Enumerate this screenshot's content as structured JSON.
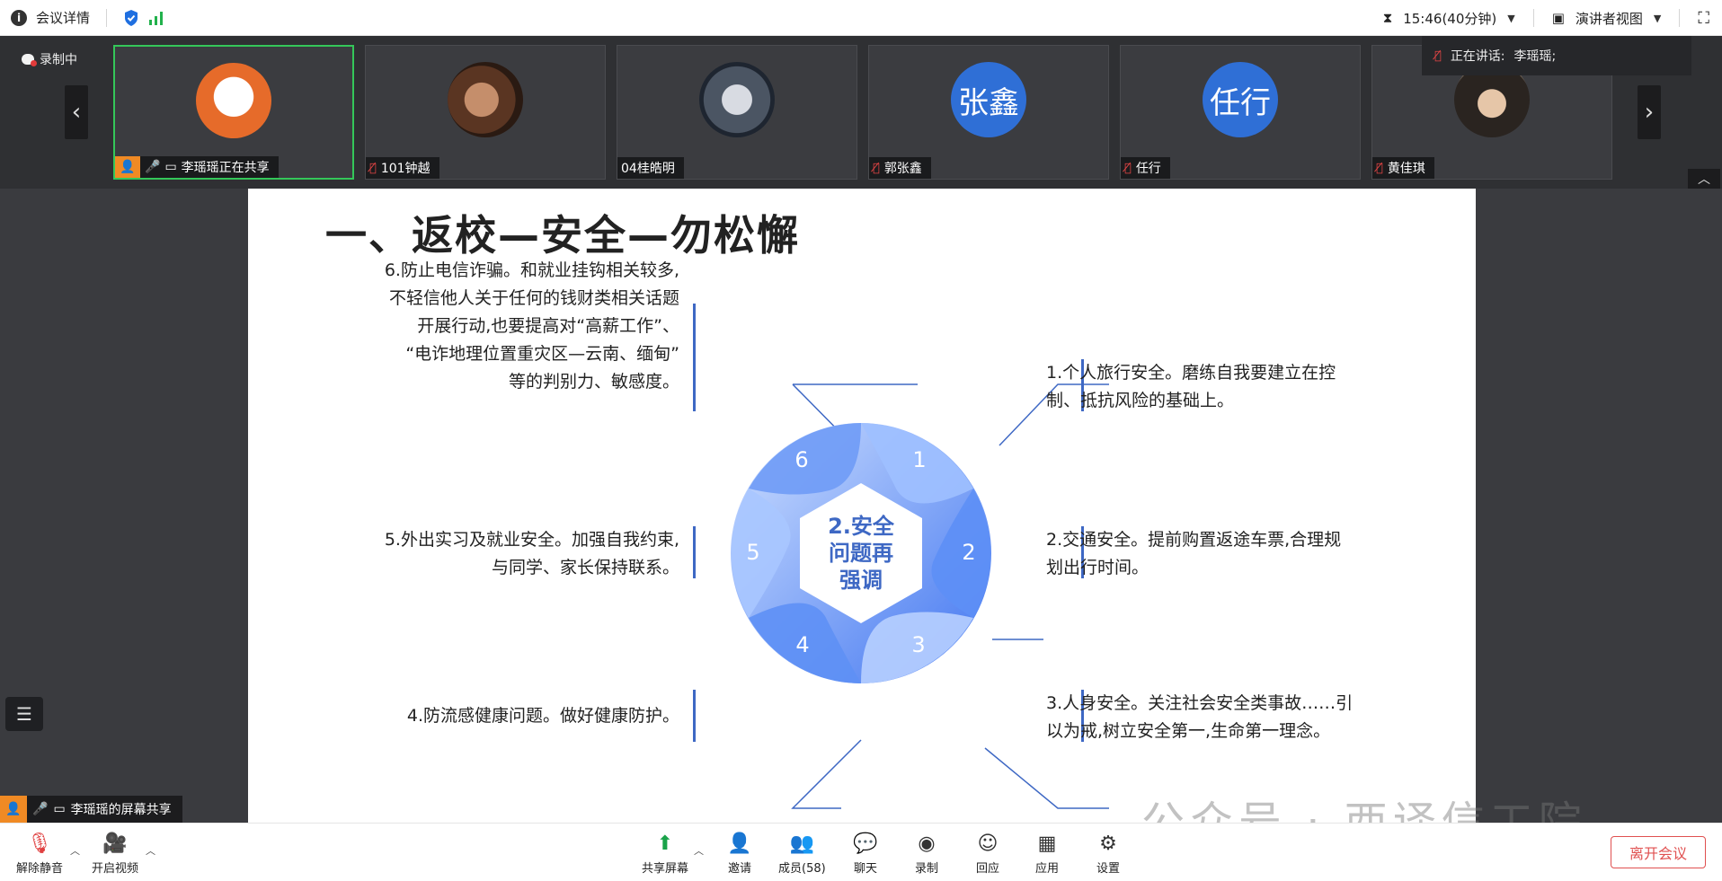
{
  "topbar": {
    "meeting_details": "会议详情",
    "time": "15:46(40分钟)",
    "view_mode": "演讲者视图"
  },
  "recording": {
    "label": "录制中"
  },
  "participants": [
    {
      "name": "李瑶瑶正在共享",
      "avatar": "",
      "muted": false,
      "active": true
    },
    {
      "name": "101钟越",
      "avatar": "",
      "muted": true,
      "active": false
    },
    {
      "name": "04桂皓明",
      "avatar": "",
      "muted": false,
      "active": false
    },
    {
      "name": "郭张鑫",
      "avatar": "张鑫",
      "muted": true,
      "active": false
    },
    {
      "name": "任行",
      "avatar": "任行",
      "muted": true,
      "active": false
    },
    {
      "name": "黄佳琪",
      "avatar": "",
      "muted": true,
      "active": false
    }
  ],
  "speaking": {
    "label": "正在讲话:",
    "name": "李瑶瑶;"
  },
  "slide": {
    "title": "一、返校—安全—勿松懈",
    "center_text": [
      "2.安全",
      "问题再",
      "强调"
    ],
    "ring_numbers": [
      "1",
      "2",
      "3",
      "4",
      "5",
      "6"
    ],
    "items": {
      "i1": [
        "1.个人旅行安全。磨练自我要建立在控",
        "制、抵抗风险的基础上。"
      ],
      "i2": [
        "2.交通安全。提前购置返途车票,合理规",
        "划出行时间。"
      ],
      "i3": [
        "3.人身安全。关注社会安全类事故……引",
        "以为戒,树立安全第一,生命第一理念。"
      ],
      "i4": [
        "4.防流感健康问题。做好健康防护。"
      ],
      "i5": [
        "5.外出实习及就业安全。加强自我约束,",
        "与同学、家长保持联系。"
      ],
      "i6": [
        "6.防止电信诈骗。和就业挂钩相关较多,",
        "不轻信他人关于任何的钱财类相关话题",
        "开展行动,也要提高对“高薪工作”、",
        "“电诈地理位置重灾区—云南、缅甸”",
        "等的判别力、敏感度。"
      ]
    }
  },
  "share_tag": "李瑶瑶的屏幕共享",
  "watermark": "公众号 · 西译信工院",
  "toolbar": {
    "unmute": "解除静音",
    "start_video": "开启视频",
    "share_screen": "共享屏幕",
    "invite": "邀请",
    "members": "成员(58)",
    "chat": "聊天",
    "record": "录制",
    "reactions": "回应",
    "apps": "应用",
    "settings": "设置",
    "leave": "离开会议"
  },
  "colors": {
    "accent_blue": "#3e68c4",
    "active_green": "#34c759",
    "leave_red": "#e05050"
  }
}
